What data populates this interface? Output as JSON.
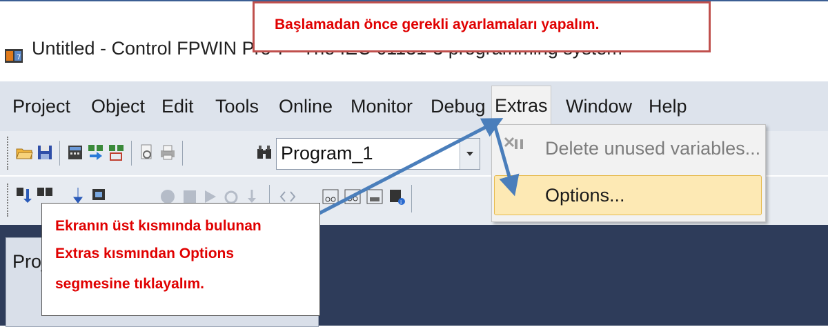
{
  "callout_top": {
    "text": "Başlamadan önce gerekli ayarlamaları yapalım."
  },
  "window": {
    "title": "Untitled - Control FPWIN Pro 7 - The IEC 61131-3 programming system"
  },
  "menu": {
    "items": [
      {
        "label": "Project"
      },
      {
        "label": "Object"
      },
      {
        "label": "Edit"
      },
      {
        "label": "Tools"
      },
      {
        "label": "Online"
      },
      {
        "label": "Monitor"
      },
      {
        "label": "Debug"
      },
      {
        "label": "Extras"
      },
      {
        "label": "Window"
      },
      {
        "label": "Help"
      }
    ]
  },
  "toolbar": {
    "program_combo_value": "Program_1"
  },
  "extras_menu": {
    "items": [
      {
        "label": "Delete unused variables...",
        "state": "disabled"
      },
      {
        "label": "Options...",
        "state": "highlighted"
      }
    ]
  },
  "panel": {
    "title": "Proj"
  },
  "callout_bottom": {
    "lines": [
      "Ekranın üst kısmında bulunan",
      "Extras kısmından Options",
      "segmesine tıklayalım."
    ]
  },
  "colors": {
    "annotation_text": "#e00000",
    "annotation_border": "#c0504d",
    "arrow": "#4a7ebb",
    "menu_highlight": "#fde9b4",
    "workspace_bg": "#2e3c5a"
  }
}
